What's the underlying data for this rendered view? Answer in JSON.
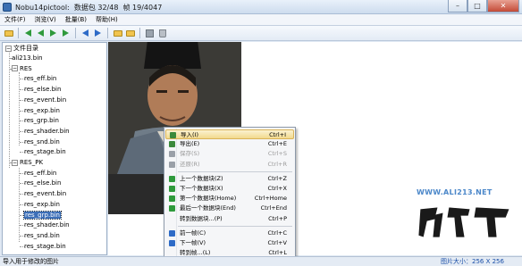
{
  "window": {
    "title": "Nobu14pictool:  数据包 32/48  帧 19/4047",
    "min": "–",
    "max": "□",
    "close": "✕"
  },
  "menu": [
    "文件(F)",
    "浏览(V)",
    "批量(B)",
    "帮助(H)"
  ],
  "toolbar": {
    "icons": [
      "open-folder-icon",
      "first-green-arrow-icon",
      "prev-green-arrow-icon",
      "next-green-arrow-icon",
      "last-green-arrow-icon",
      "prev-blue-arrow-icon",
      "next-blue-arrow-icon",
      "folder-icon",
      "folder-icon",
      "save-icon",
      "trash-icon"
    ]
  },
  "tree": {
    "root": "文件目录",
    "items": [
      {
        "label": "ali213.bin",
        "depth": 1
      },
      {
        "label": "RES",
        "depth": 1,
        "expandable": true
      },
      {
        "label": "res_eff.bin",
        "depth": 2
      },
      {
        "label": "res_else.bin",
        "depth": 2
      },
      {
        "label": "res_event.bin",
        "depth": 2
      },
      {
        "label": "res_exp.bin",
        "depth": 2
      },
      {
        "label": "res_grp.bin",
        "depth": 2
      },
      {
        "label": "res_shader.bin",
        "depth": 2
      },
      {
        "label": "res_snd.bin",
        "depth": 2
      },
      {
        "label": "res_stage.bin",
        "depth": 2
      },
      {
        "label": "RES_PK",
        "depth": 1,
        "expandable": true
      },
      {
        "label": "res_eff.bin",
        "depth": 2
      },
      {
        "label": "res_else.bin",
        "depth": 2
      },
      {
        "label": "res_event.bin",
        "depth": 2
      },
      {
        "label": "res_exp.bin",
        "depth": 2
      },
      {
        "label": "res_grp.bin",
        "depth": 2,
        "selected": true
      },
      {
        "label": "res_shader.bin",
        "depth": 2
      },
      {
        "label": "res_snd.bin",
        "depth": 2
      },
      {
        "label": "res_stage.bin",
        "depth": 2
      }
    ]
  },
  "context_menu": {
    "items": [
      {
        "label": "导入(I)",
        "shortcut": "Ctrl+I",
        "icon": "import-icon",
        "highlighted": true
      },
      {
        "label": "导出(E)",
        "shortcut": "Ctrl+E",
        "icon": "export-icon"
      },
      {
        "label": "保存(S)",
        "shortcut": "Ctrl+S",
        "icon": "save-icon",
        "disabled": true
      },
      {
        "label": "还原(R)",
        "shortcut": "Ctrl+R",
        "icon": "restore-icon",
        "disabled": true
      },
      {
        "sep": true
      },
      {
        "label": "上一个数据块(Z)",
        "shortcut": "Ctrl+Z",
        "icon": "prev-block-icon"
      },
      {
        "label": "下一个数据块(X)",
        "shortcut": "Ctrl+X",
        "icon": "next-block-icon"
      },
      {
        "label": "第一个数据块(Home)",
        "shortcut": "Ctrl+Home",
        "icon": "first-block-icon"
      },
      {
        "label": "最后一个数据块(End)",
        "shortcut": "Ctrl+End",
        "icon": "last-block-icon"
      },
      {
        "label": "转到数据块...(P)",
        "shortcut": "Ctrl+P",
        "icon": ""
      },
      {
        "sep": true
      },
      {
        "label": "前一帧(C)",
        "shortcut": "Ctrl+C",
        "icon": "prev-frame-icon"
      },
      {
        "label": "下一帧(V)",
        "shortcut": "Ctrl+V",
        "icon": "next-frame-icon"
      },
      {
        "label": "转到帧...(L)",
        "shortcut": "Ctrl+L",
        "icon": ""
      }
    ]
  },
  "status": {
    "left": "导入用于修改的图片",
    "right": "图片大小：256 X 256"
  },
  "watermark": {
    "url": "WWW.ALI213.NET"
  },
  "colors": {
    "selection": "#3c6fb8",
    "menu_highlight": "#f2d98c",
    "watermark": "#4b87c9"
  }
}
